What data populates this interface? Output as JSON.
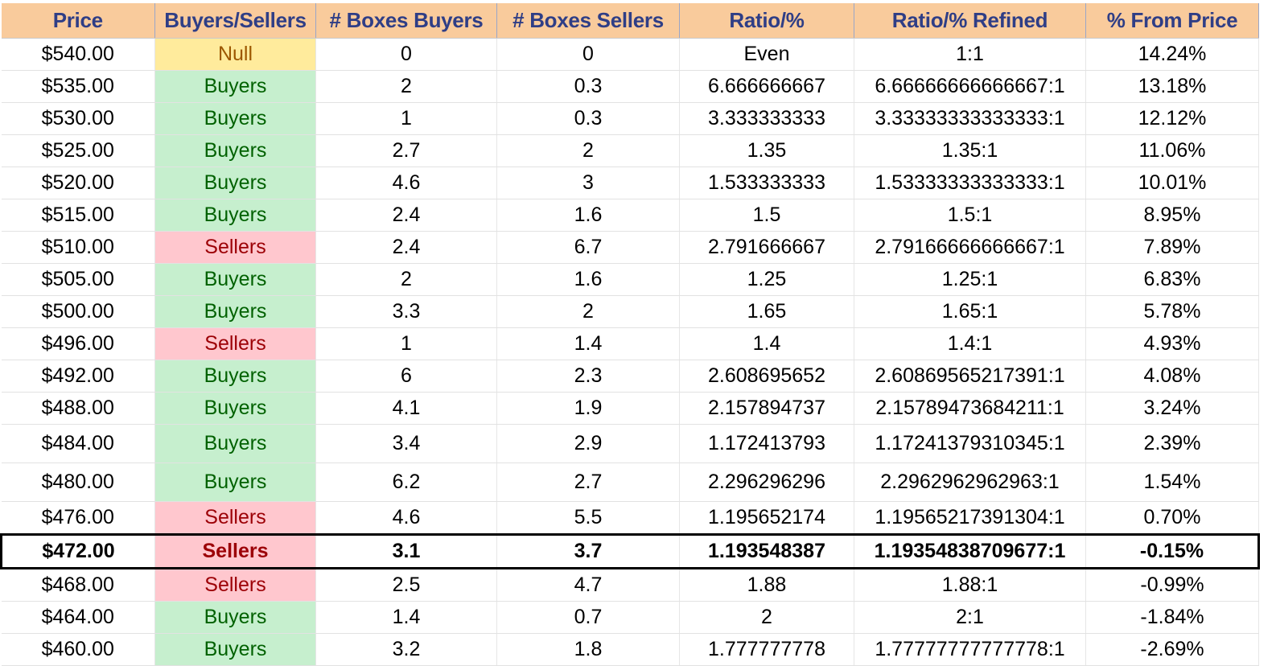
{
  "headers": [
    "Price",
    "Buyers/Sellers",
    "# Boxes Buyers",
    "# Boxes Sellers",
    "Ratio/%",
    "Ratio/% Refined",
    "% From Price"
  ],
  "colors": {
    "header_bg": "#f9cb9c",
    "header_text": "#2f3e86",
    "buyers_bg": "#c6efce",
    "buyers_text": "#006100",
    "sellers_bg": "#ffc7ce",
    "sellers_text": "#9c0006",
    "null_bg": "#ffeb9c",
    "null_text": "#9c5700"
  },
  "rows": [
    {
      "price": "$540.00",
      "side": "Null",
      "boxes_buyers": "0",
      "boxes_sellers": "0",
      "ratio": "Even",
      "ratio_refined": "1:1",
      "from_price": "14.24%"
    },
    {
      "price": "$535.00",
      "side": "Buyers",
      "boxes_buyers": "2",
      "boxes_sellers": "0.3",
      "ratio": "6.666666667",
      "ratio_refined": "6.66666666666667:1",
      "from_price": "13.18%"
    },
    {
      "price": "$530.00",
      "side": "Buyers",
      "boxes_buyers": "1",
      "boxes_sellers": "0.3",
      "ratio": "3.333333333",
      "ratio_refined": "3.33333333333333:1",
      "from_price": "12.12%"
    },
    {
      "price": "$525.00",
      "side": "Buyers",
      "boxes_buyers": "2.7",
      "boxes_sellers": "2",
      "ratio": "1.35",
      "ratio_refined": "1.35:1",
      "from_price": "11.06%"
    },
    {
      "price": "$520.00",
      "side": "Buyers",
      "boxes_buyers": "4.6",
      "boxes_sellers": "3",
      "ratio": "1.533333333",
      "ratio_refined": "1.53333333333333:1",
      "from_price": "10.01%"
    },
    {
      "price": "$515.00",
      "side": "Buyers",
      "boxes_buyers": "2.4",
      "boxes_sellers": "1.6",
      "ratio": "1.5",
      "ratio_refined": "1.5:1",
      "from_price": "8.95%"
    },
    {
      "price": "$510.00",
      "side": "Sellers",
      "boxes_buyers": "2.4",
      "boxes_sellers": "6.7",
      "ratio": "2.791666667",
      "ratio_refined": "2.79166666666667:1",
      "from_price": "7.89%"
    },
    {
      "price": "$505.00",
      "side": "Buyers",
      "boxes_buyers": "2",
      "boxes_sellers": "1.6",
      "ratio": "1.25",
      "ratio_refined": "1.25:1",
      "from_price": "6.83%"
    },
    {
      "price": "$500.00",
      "side": "Buyers",
      "boxes_buyers": "3.3",
      "boxes_sellers": "2",
      "ratio": "1.65",
      "ratio_refined": "1.65:1",
      "from_price": "5.78%"
    },
    {
      "price": "$496.00",
      "side": "Sellers",
      "boxes_buyers": "1",
      "boxes_sellers": "1.4",
      "ratio": "1.4",
      "ratio_refined": "1.4:1",
      "from_price": "4.93%"
    },
    {
      "price": "$492.00",
      "side": "Buyers",
      "boxes_buyers": "6",
      "boxes_sellers": "2.3",
      "ratio": "2.608695652",
      "ratio_refined": "2.60869565217391:1",
      "from_price": "4.08%"
    },
    {
      "price": "$488.00",
      "side": "Buyers",
      "boxes_buyers": "4.1",
      "boxes_sellers": "1.9",
      "ratio": "2.157894737",
      "ratio_refined": "2.15789473684211:1",
      "from_price": "3.24%"
    },
    {
      "price": "$484.00",
      "side": "Buyers",
      "boxes_buyers": "3.4",
      "boxes_sellers": "2.9",
      "ratio": "1.172413793",
      "ratio_refined": "1.17241379310345:1",
      "from_price": "2.39%"
    },
    {
      "price": "$480.00",
      "side": "Buyers",
      "boxes_buyers": "6.2",
      "boxes_sellers": "2.7",
      "ratio": "2.296296296",
      "ratio_refined": "2.2962962962963:1",
      "from_price": "1.54%"
    },
    {
      "price": "$476.00",
      "side": "Sellers",
      "boxes_buyers": "4.6",
      "boxes_sellers": "5.5",
      "ratio": "1.195652174",
      "ratio_refined": "1.19565217391304:1",
      "from_price": "0.70%"
    },
    {
      "price": "$472.00",
      "side": "Sellers",
      "boxes_buyers": "3.1",
      "boxes_sellers": "3.7",
      "ratio": "1.193548387",
      "ratio_refined": "1.19354838709677:1",
      "from_price": "-0.15%",
      "current": true
    },
    {
      "price": "$468.00",
      "side": "Sellers",
      "boxes_buyers": "2.5",
      "boxes_sellers": "4.7",
      "ratio": "1.88",
      "ratio_refined": "1.88:1",
      "from_price": "-0.99%"
    },
    {
      "price": "$464.00",
      "side": "Buyers",
      "boxes_buyers": "1.4",
      "boxes_sellers": "0.7",
      "ratio": "2",
      "ratio_refined": "2:1",
      "from_price": "-1.84%"
    },
    {
      "price": "$460.00",
      "side": "Buyers",
      "boxes_buyers": "3.2",
      "boxes_sellers": "1.8",
      "ratio": "1.777777778",
      "ratio_refined": "1.77777777777778:1",
      "from_price": "-2.69%"
    }
  ]
}
